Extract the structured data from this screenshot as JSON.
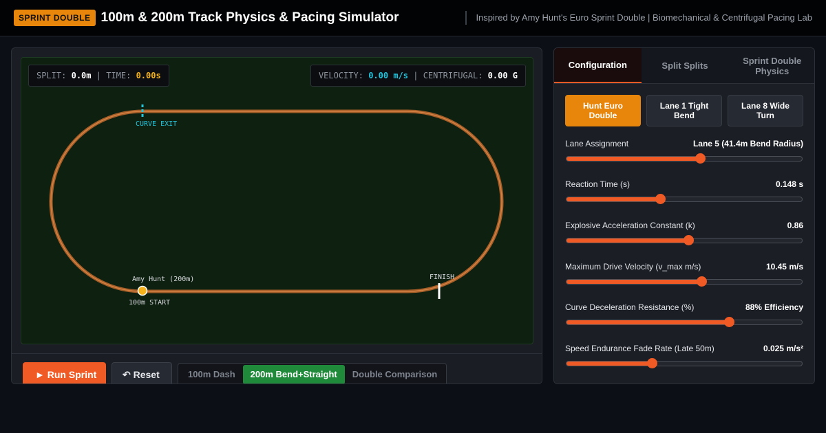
{
  "header": {
    "badge": "SPRINT DOUBLE",
    "title": "100m & 200m Track Physics & Pacing Simulator",
    "subtitle": "Inspired by Amy Hunt's Euro Sprint Double | Biomechanical & Centrifugal Pacing Lab"
  },
  "readouts": {
    "split_label": "SPLIT:",
    "split_value": "0.0m",
    "time_label": "TIME:",
    "time_value": "0.00s",
    "velocity_label": "VELOCITY:",
    "velocity_value": "0.00 m/s",
    "centrifugal_label": "CENTRIFUGAL:",
    "centrifugal_value": "0.00 G",
    "separator": "|"
  },
  "track": {
    "curve_exit_label": "CURVE EXIT",
    "runner_label": "Amy Hunt (200m)",
    "start_label": "100m START",
    "finish_label": "FINISH",
    "colors": {
      "lane": "#d27a35",
      "runner": "#f5b21d",
      "marker": "#21c4dc",
      "finish": "#ffffff"
    }
  },
  "controls": {
    "run_icon": "play-icon",
    "run_label": "Run Sprint",
    "run_glyph": "►",
    "reset_icon": "undo-icon",
    "reset_label": "Reset",
    "reset_glyph": "↶",
    "modes": [
      {
        "label": "100m Dash",
        "active": false
      },
      {
        "label": "200m Bend+Straight",
        "active": true
      },
      {
        "label": "Double Comparison",
        "active": false
      }
    ]
  },
  "tabs": [
    {
      "label": "Configuration",
      "active": true
    },
    {
      "label": "Split Splits",
      "active": false
    },
    {
      "label": "Sprint Double Physics",
      "active": false
    }
  ],
  "presets": [
    {
      "label": "Hunt Euro Double",
      "active": true
    },
    {
      "label": "Lane 1 Tight Bend",
      "active": false
    },
    {
      "label": "Lane 8 Wide Turn",
      "active": false
    }
  ],
  "params": [
    {
      "label": "Lane Assignment",
      "value": "Lane 5 (41.4m Bend Radius)",
      "level": 0.571
    },
    {
      "label": "Reaction Time (s)",
      "value": "0.148 s",
      "level": 0.4
    },
    {
      "label": "Explosive Acceleration Constant (k)",
      "value": "0.86",
      "level": 0.52
    },
    {
      "label": "Maximum Drive Velocity (v_max m/s)",
      "value": "10.45 m/s",
      "level": 0.575
    },
    {
      "label": "Curve Deceleration Resistance (%)",
      "value": "88% Efficiency",
      "level": 0.693
    },
    {
      "label": "Speed Endurance Fade Rate (Late 50m)",
      "value": "0.025 m/s²",
      "level": 0.366
    }
  ],
  "accent": "#f05a24",
  "badge_color": "#e8860c"
}
